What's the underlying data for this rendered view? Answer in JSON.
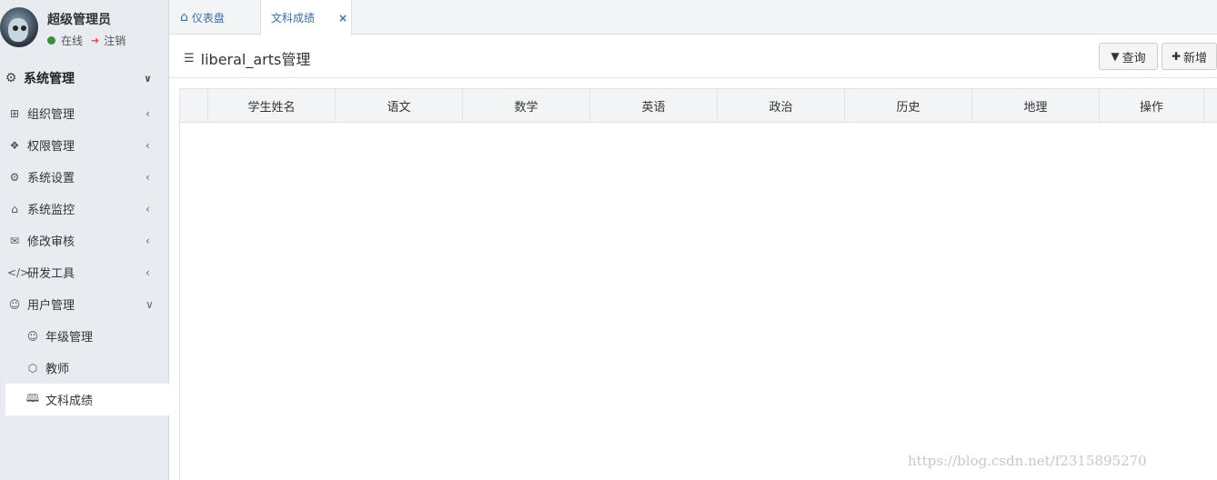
{
  "user": {
    "name": "超级管理员",
    "status": "在线",
    "logout": "注销"
  },
  "menu": {
    "header": {
      "label": "系统管理",
      "icon": "gear-icon"
    },
    "items": [
      {
        "label": "组织管理",
        "icon": "grid-icon"
      },
      {
        "label": "权限管理",
        "icon": "dropbox-icon"
      },
      {
        "label": "系统设置",
        "icon": "gear-icon"
      },
      {
        "label": "系统监控",
        "icon": "ghost-icon"
      },
      {
        "label": "修改审核",
        "icon": "envelope-open-icon"
      },
      {
        "label": "研发工具",
        "icon": "code-icon"
      },
      {
        "label": "用户管理",
        "icon": "user-icon"
      }
    ],
    "subitems": [
      {
        "label": "年级管理",
        "icon": "user-icon"
      },
      {
        "label": "教师",
        "icon": "layers-icon"
      },
      {
        "label": "文科成绩",
        "icon": "book-icon",
        "active": true
      }
    ]
  },
  "tabs": [
    {
      "label": "仪表盘",
      "icon": "home-icon"
    },
    {
      "label": "文科成绩",
      "active": true,
      "close": "×"
    }
  ],
  "page": {
    "title": "liberal_arts管理",
    "query_label": "查询",
    "add_label": "新增"
  },
  "table": {
    "columns": [
      "学生姓名",
      "语文",
      "数学",
      "英语",
      "政治",
      "历史",
      "地理",
      "操作"
    ]
  },
  "watermark": "https://blog.csdn.net/f2315895270"
}
